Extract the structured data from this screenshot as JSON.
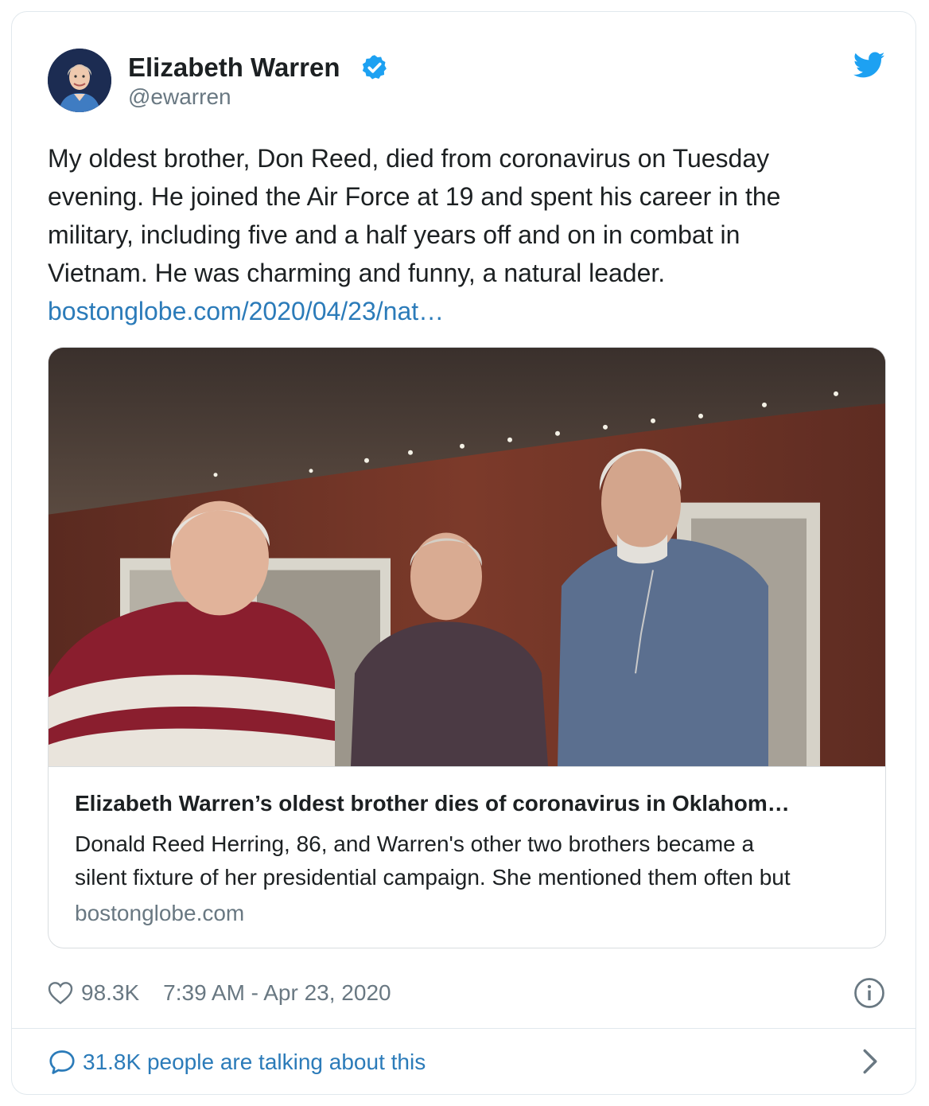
{
  "author": {
    "name": "Elizabeth Warren",
    "handle": "@ewarren",
    "verified": true,
    "avatar_icon": "profile-photo"
  },
  "brand": {
    "logo_icon": "twitter-bird-icon",
    "accent": "#1da1f2",
    "link_color": "#2b7bb9"
  },
  "tweet": {
    "lines": [
      "My oldest brother, Don Reed, died from coronavirus on Tuesday",
      "evening. He joined the Air Force at 19 and spent his career in the",
      "military, including five and a half years off and on in combat in",
      "Vietnam. He was charming and funny, a natural leader."
    ],
    "link": "bostonglobe.com/2020/04/23/nat…"
  },
  "card": {
    "title": "Elizabeth Warren’s oldest brother dies of coronavirus in Oklahom…",
    "description_lines": [
      "Donald Reed Herring, 86, and Warren's other two brothers became a",
      "silent fixture of her presidential campaign. She mentioned them often but"
    ],
    "domain": "bostonglobe.com"
  },
  "footer": {
    "like_icon": "heart-icon",
    "likes": "98.3K",
    "timestamp": "7:39 AM - Apr 23, 2020",
    "info_icon": "info-icon"
  },
  "conversation": {
    "icon": "speech-bubble-icon",
    "label": "31.8K people are talking about this",
    "chevron_icon": "chevron-right-icon"
  }
}
